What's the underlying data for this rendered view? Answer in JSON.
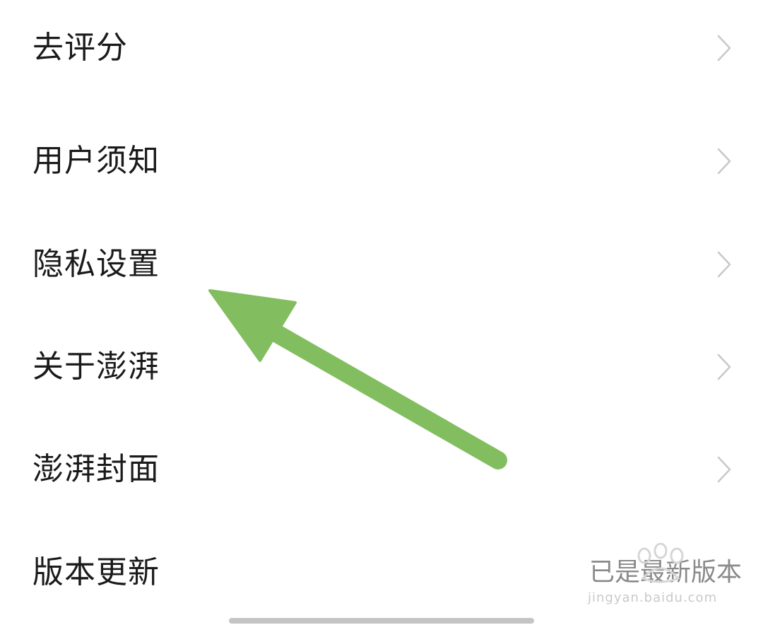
{
  "menu": {
    "items": [
      {
        "label": "去评分"
      },
      {
        "label": "用户须知"
      },
      {
        "label": "隐私设置"
      },
      {
        "label": "关于澎湃"
      },
      {
        "label": "澎湃封面"
      },
      {
        "label": "版本更新",
        "value": "已是最新版本"
      }
    ]
  },
  "watermark": {
    "text": "jingyan.baidu.com",
    "logo": "baidu-paw-logo"
  },
  "annotation": {
    "arrow_color": "#82BE5F",
    "points_to": "隐私设置"
  },
  "colors": {
    "background": "#ffffff",
    "text": "#1a1a1a",
    "chevron": "#c8c8c8",
    "secondary_text": "#8a8a8a"
  }
}
